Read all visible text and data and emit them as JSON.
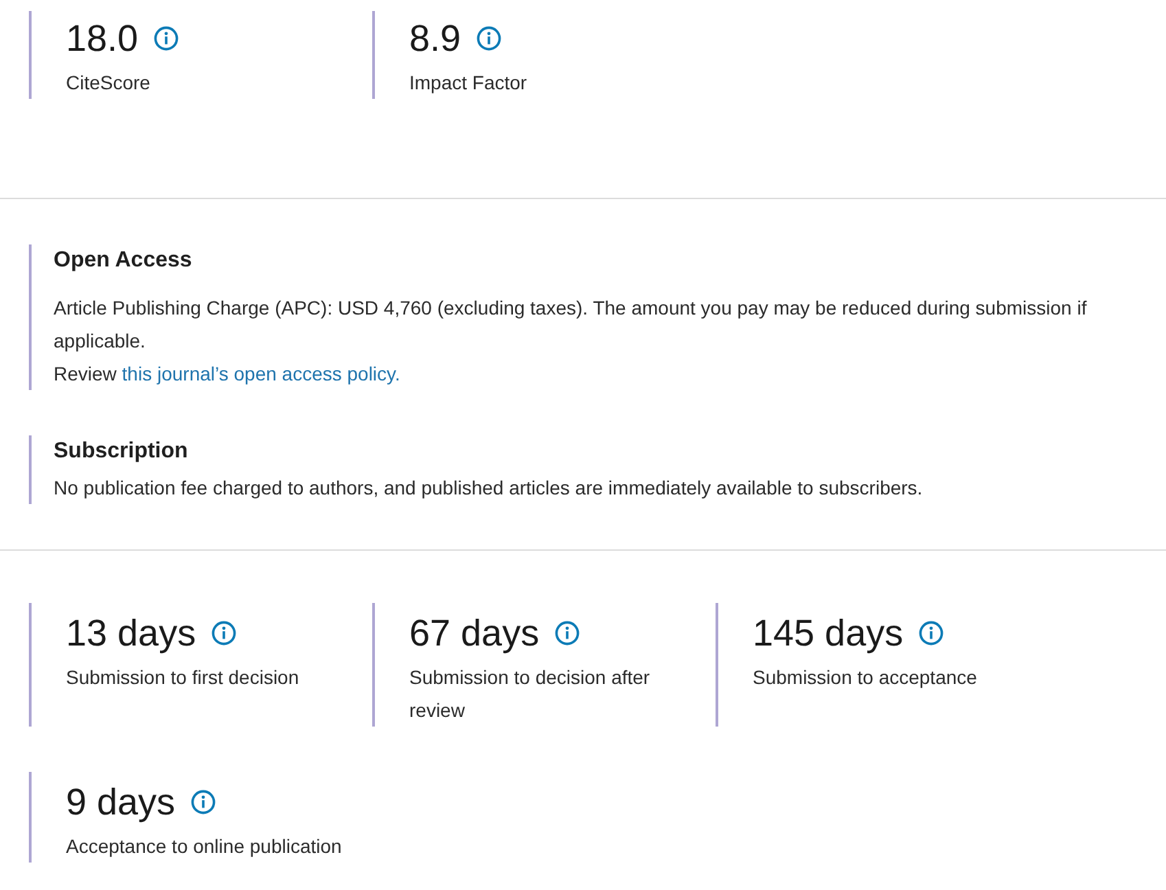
{
  "metrics": [
    {
      "value": "18.0",
      "label": "CiteScore"
    },
    {
      "value": "8.9",
      "label": "Impact Factor"
    }
  ],
  "access_options": [
    {
      "title": "Open Access",
      "description": "Article Publishing Charge (APC): USD 4,760 (excluding taxes). The amount you pay may be reduced during submission if applicable.",
      "review": {
        "prefix": "Review",
        "link": "this journal’s open access policy."
      }
    },
    {
      "title": "Subscription",
      "description": "No publication fee charged to authors, and published articles are immediately available to subscribers."
    }
  ],
  "timings": [
    {
      "value": "13 days",
      "label": "Submission to first decision"
    },
    {
      "value": "67 days",
      "label": "Submission to decision after review"
    },
    {
      "value": "145 days",
      "label": "Submission to acceptance"
    },
    {
      "value": "9 days",
      "label": "Acceptance to online publication"
    }
  ]
}
